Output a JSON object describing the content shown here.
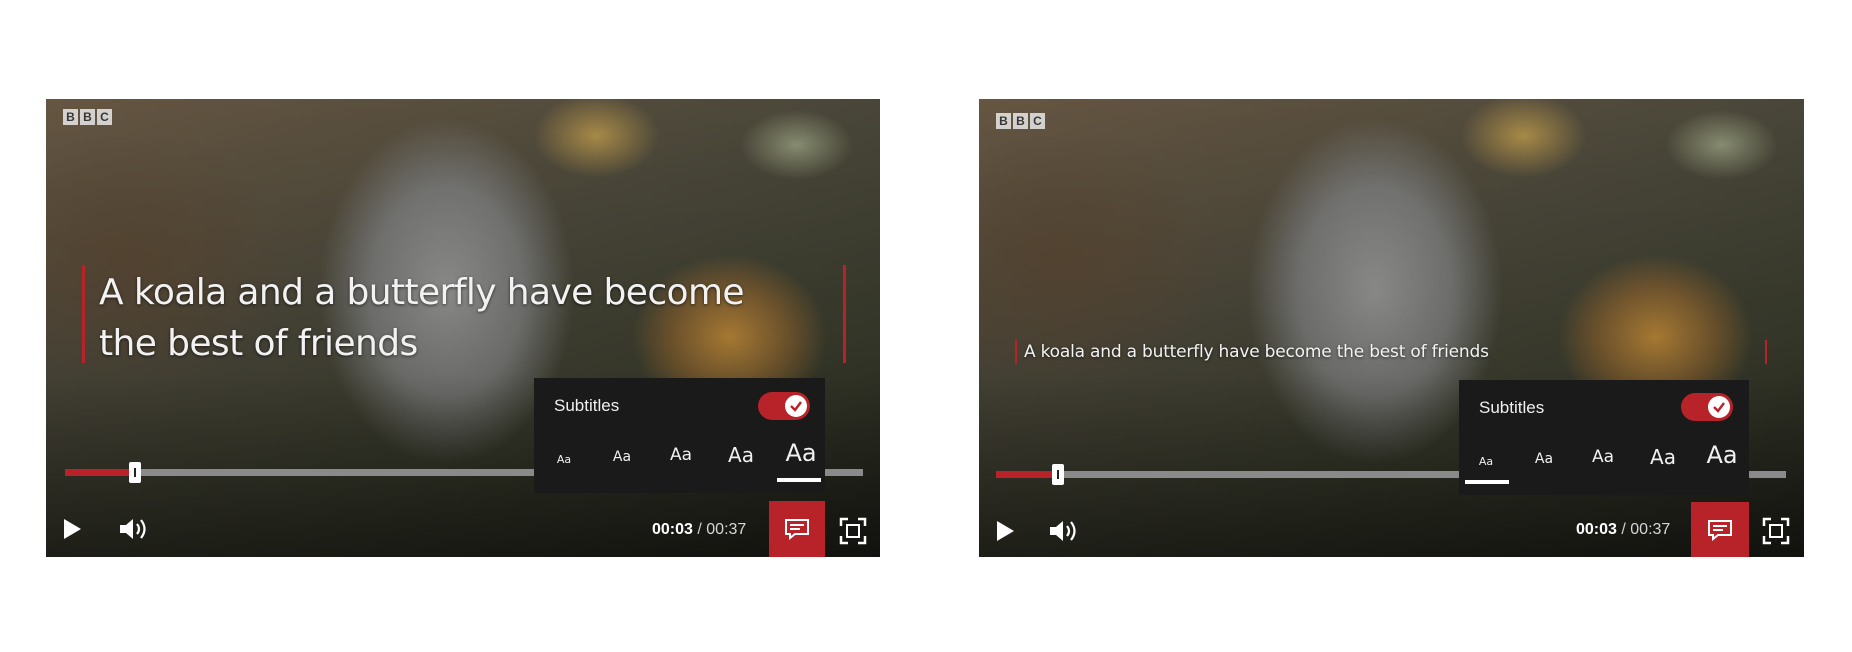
{
  "players": [
    {
      "id": "left",
      "logo": [
        "B",
        "B",
        "C"
      ],
      "caption_lines": [
        "A koala and a butterfly have become",
        "the best of friends"
      ],
      "progress_fraction": 0.088,
      "time": {
        "current": "00:03",
        "separator": " / ",
        "duration": "00:37"
      },
      "subtitles_panel": {
        "title": "Subtitles",
        "toggle_on": true,
        "sizes": [
          "Aa",
          "Aa",
          "Aa",
          "Aa",
          "Aa"
        ],
        "selected_size_index": 4
      }
    },
    {
      "id": "right",
      "logo": [
        "B",
        "B",
        "C"
      ],
      "caption_lines": [
        "A koala and a butterfly have become the best of friends"
      ],
      "progress_fraction": 0.078,
      "time": {
        "current": "00:03",
        "separator": " / ",
        "duration": "00:37"
      },
      "subtitles_panel": {
        "title": "Subtitles",
        "toggle_on": true,
        "sizes": [
          "Aa",
          "Aa",
          "Aa",
          "Aa",
          "Aa"
        ],
        "selected_size_index": 0
      }
    }
  ],
  "icons": {
    "play": "play-icon",
    "volume": "volume-icon",
    "subtitles": "subtitles-icon",
    "fullscreen": "fullscreen-icon",
    "check": "check-icon"
  },
  "colors": {
    "accent": "#b8232a",
    "panel": "#1a1a1a",
    "track": "#8a8a8a"
  }
}
